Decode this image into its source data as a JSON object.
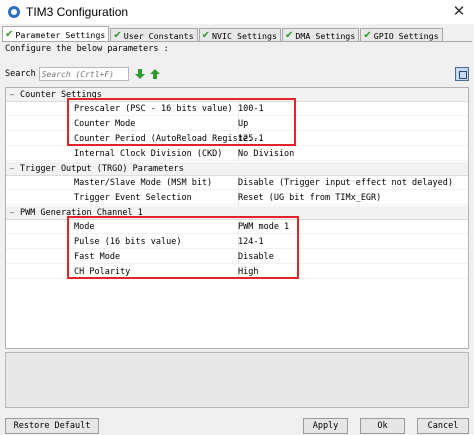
{
  "window": {
    "title": "TIM3 Configuration",
    "close_glyph": "✕"
  },
  "tabs": [
    {
      "label": "Parameter Settings"
    },
    {
      "label": "User Constants"
    },
    {
      "label": "NVIC Settings"
    },
    {
      "label": "DMA Settings"
    },
    {
      "label": "GPIO Settings"
    }
  ],
  "configure_text": "Configure the below parameters :",
  "search": {
    "label": "Search",
    "placeholder": "Search (Crtl+F)"
  },
  "groups": [
    {
      "label": "Counter Settings",
      "params": [
        {
          "name": "Prescaler (PSC - 16 bits value)",
          "value": "100-1"
        },
        {
          "name": "Counter Mode",
          "value": "Up"
        },
        {
          "name": "Counter Period (AutoReload Registe...",
          "value": "125-1"
        },
        {
          "name": "Internal Clock Division (CKD)",
          "value": "No Division"
        }
      ]
    },
    {
      "label": "Trigger Output (TRGO) Parameters",
      "params": [
        {
          "name": "Master/Slave Mode (MSM bit)",
          "value": "Disable (Trigger input effect not delayed)"
        },
        {
          "name": "Trigger Event Selection",
          "value": "Reset (UG bit from TIMx_EGR)"
        }
      ]
    },
    {
      "label": "PWM Generation Channel 1",
      "params": [
        {
          "name": "Mode",
          "value": "PWM mode 1"
        },
        {
          "name": "Pulse (16 bits value)",
          "value": "124-1"
        },
        {
          "name": "Fast Mode",
          "value": "Disable"
        },
        {
          "name": "CH Polarity",
          "value": "High"
        }
      ]
    }
  ],
  "buttons": {
    "restore": "Restore Default",
    "apply": "Apply",
    "ok": "Ok",
    "cancel": "Cancel"
  },
  "colors": {
    "highlight": "#e0262b",
    "check": "#2e9b2e",
    "arrow": "#2e9b2e"
  }
}
